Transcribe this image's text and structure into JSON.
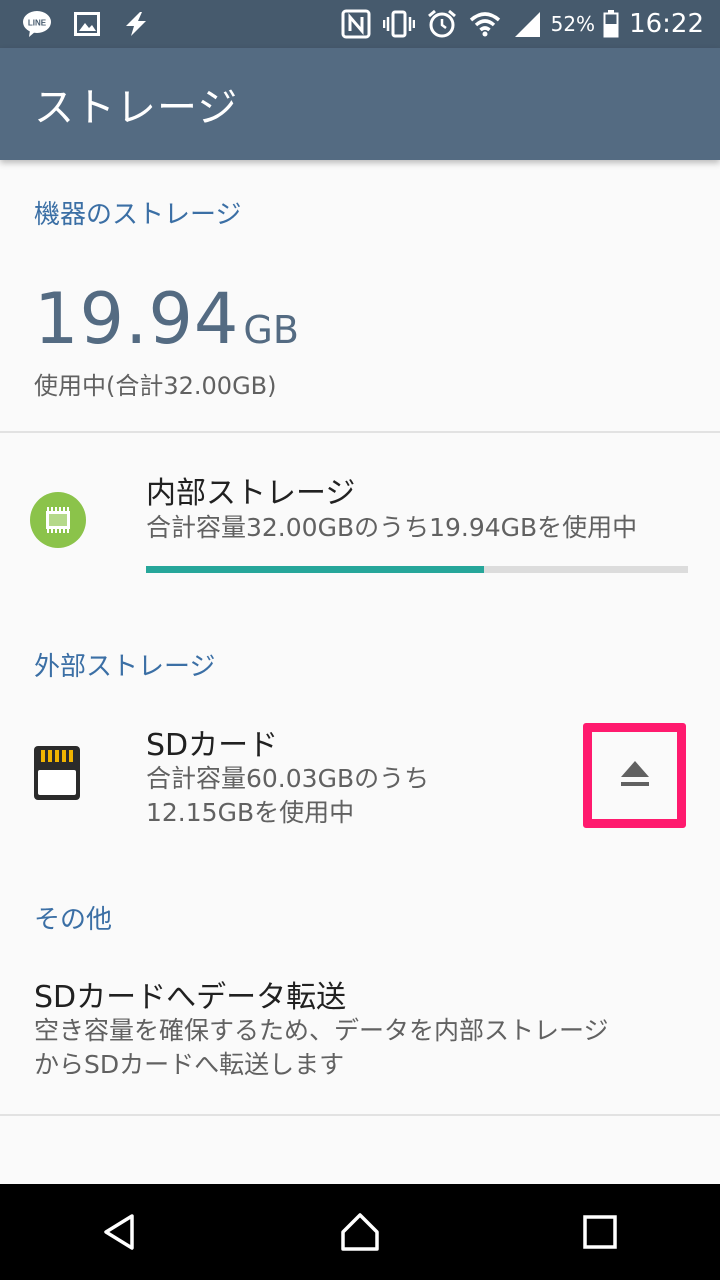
{
  "status_bar": {
    "left_icons": [
      "line-icon",
      "image-icon",
      "flash-icon"
    ],
    "right_icons": [
      "nfc-icon",
      "vibrate-icon",
      "alarm-icon",
      "wifi-icon",
      "signal-icon",
      "battery-icon"
    ],
    "battery": "52%",
    "time": "16:22"
  },
  "app_bar": {
    "title": "ストレージ"
  },
  "device_storage": {
    "header": "機器のストレージ",
    "used_value": "19.94",
    "used_unit": "GB",
    "used_summary": "使用中(合計32.00GB)"
  },
  "internal_storage": {
    "icon": "chip-icon",
    "title": "内部ストレージ",
    "summary": "合計容量32.00GBのうち19.94GBを使用中",
    "used_fraction": 0.623
  },
  "external_storage": {
    "header": "外部ストレージ",
    "sd_card": {
      "icon": "sd-card-icon",
      "title": "SDカード",
      "summary_line1": "合計容量60.03GBのうち",
      "summary_line2": "12.15GBを使用中",
      "eject_icon": "eject-icon"
    }
  },
  "other": {
    "header": "その他",
    "transfer": {
      "title": "SDカードへデータ転送",
      "desc_line1": "空き容量を確保するため、データを内部ストレージ",
      "desc_line2": "からSDカードへ転送します"
    }
  },
  "colors": {
    "status_bar": "#465a6d",
    "app_bar": "#546b82",
    "section_header": "#3b6fa5",
    "progress_fill": "#26a69a",
    "highlight": "#ff1a6e",
    "chip_icon": "#8bc34a"
  },
  "nav_bar": {
    "buttons": [
      "back-icon",
      "home-icon",
      "recents-icon"
    ]
  }
}
